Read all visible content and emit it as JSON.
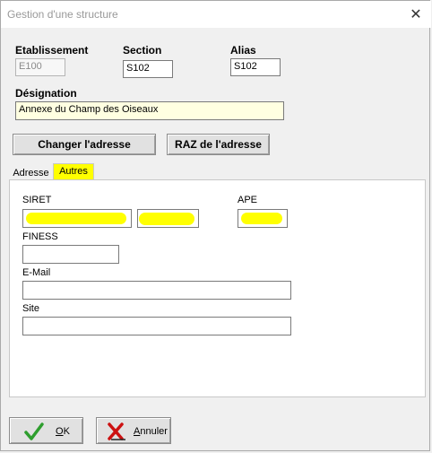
{
  "window": {
    "title": "Gestion d'une structure",
    "close_glyph": "✕"
  },
  "fields": {
    "etablissement": {
      "label": "Etablissement",
      "value": "E100"
    },
    "section": {
      "label": "Section",
      "value": "S102"
    },
    "alias": {
      "label": "Alias",
      "value": "S102"
    },
    "designation": {
      "label": "Désignation",
      "value": "Annexe du Champ des Oiseaux"
    }
  },
  "buttons": {
    "changer_adresse": "Changer l'adresse",
    "raz_adresse": "RAZ de l'adresse"
  },
  "tabs": [
    {
      "label": "Adresse",
      "active": false
    },
    {
      "label": "Autres",
      "active": true
    }
  ],
  "autres": {
    "siret_label": "SIRET",
    "ape_label": "APE",
    "finess_label": "FINESS",
    "email_label": "E-Mail",
    "site_label": "Site",
    "finess_value": "",
    "email_value": "",
    "site_value": ""
  },
  "footer": {
    "ok": {
      "mnemonic": "O",
      "rest": "K"
    },
    "annuler": {
      "mnemonic": "A",
      "rest": "nnuler"
    }
  },
  "colors": {
    "redaction_highlight": "#ffff00",
    "designation_bg": "#ffffe1",
    "ok_icon": "#2e9e2e",
    "cancel_icon": "#cc1111"
  }
}
